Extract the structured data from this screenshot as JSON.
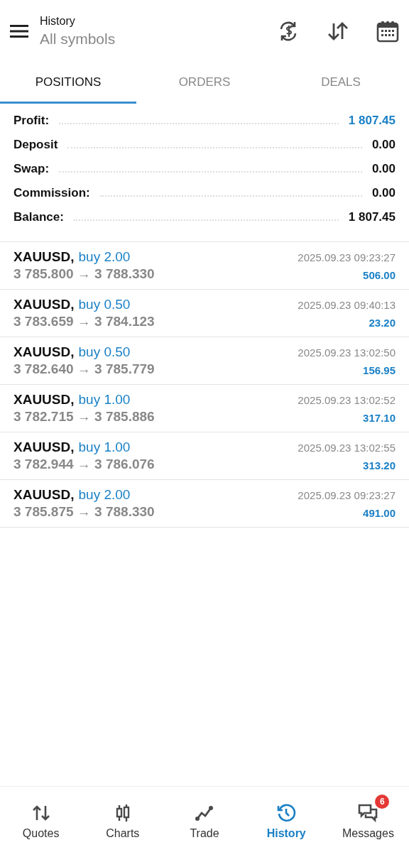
{
  "header": {
    "title": "History",
    "subtitle": "All symbols"
  },
  "tabs": [
    {
      "label": "POSITIONS",
      "selected": true
    },
    {
      "label": "ORDERS",
      "selected": false
    },
    {
      "label": "DEALS",
      "selected": false
    }
  ],
  "summary": [
    {
      "label": "Profit:",
      "value": "1 807.45",
      "highlight": true
    },
    {
      "label": "Deposit",
      "value": "0.00",
      "highlight": false
    },
    {
      "label": "Swap:",
      "value": "0.00",
      "highlight": false
    },
    {
      "label": "Commission:",
      "value": "0.00",
      "highlight": false
    },
    {
      "label": "Balance:",
      "value": "1 807.45",
      "highlight": false
    }
  ],
  "positions": [
    {
      "symbol": "XAUUSD,",
      "side": "buy 2.00",
      "prices": "3 785.800 → 3 788.330",
      "time": "2025.09.23 09:23:27",
      "profit": "506.00"
    },
    {
      "symbol": "XAUUSD,",
      "side": "buy 0.50",
      "prices": "3 783.659 → 3 784.123",
      "time": "2025.09.23 09:40:13",
      "profit": "23.20"
    },
    {
      "symbol": "XAUUSD,",
      "side": "buy 0.50",
      "prices": "3 782.640 → 3 785.779",
      "time": "2025.09.23 13:02:50",
      "profit": "156.95"
    },
    {
      "symbol": "XAUUSD,",
      "side": "buy 1.00",
      "prices": "3 782.715 → 3 785.886",
      "time": "2025.09.23 13:02:52",
      "profit": "317.10"
    },
    {
      "symbol": "XAUUSD,",
      "side": "buy 1.00",
      "prices": "3 782.944 → 3 786.076",
      "time": "2025.09.23 13:02:55",
      "profit": "313.20"
    },
    {
      "symbol": "XAUUSD,",
      "side": "buy 2.00",
      "prices": "3 785.875 → 3 788.330",
      "time": "2025.09.23 09:23:27",
      "profit": "491.00"
    }
  ],
  "nav": [
    {
      "kind": "quotes",
      "label": "Quotes",
      "selected": false
    },
    {
      "kind": "charts",
      "label": "Charts",
      "selected": false
    },
    {
      "kind": "trade",
      "label": "Trade",
      "selected": false
    },
    {
      "kind": "history",
      "label": "History",
      "selected": true
    },
    {
      "kind": "messages",
      "label": "Messages",
      "selected": false,
      "badge": "6"
    }
  ]
}
